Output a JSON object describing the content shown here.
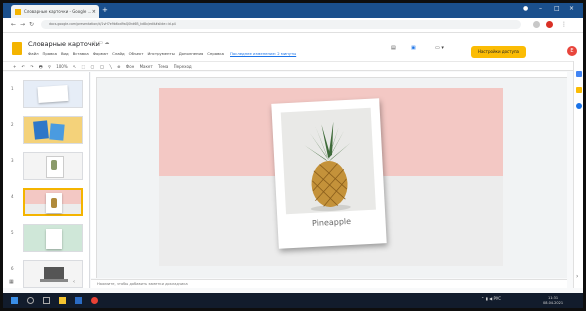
{
  "browser": {
    "tab_title": "Словарные карточки - Google ...",
    "url": "docs.google.com/presentation/d/1vH7e9b6xd9aQ0hd6B_kd8x/edit#slide=id.p4"
  },
  "app": {
    "doc_title": "Словарные карточки",
    "menu": [
      "Файл",
      "Правка",
      "Вид",
      "Вставка",
      "Формат",
      "Слайд",
      "Объект",
      "Инструменты",
      "Дополнения",
      "Справка"
    ],
    "last_edit_note": "Последнее изменение: 2 минуты",
    "share_label": "Настройки доступа",
    "avatar_letter": "Е"
  },
  "toolbar": {
    "items": [
      "+",
      "↶",
      "↷",
      "🖶",
      "⚲",
      "100%",
      "↖",
      "⬚",
      "▢",
      "◯",
      "╲",
      "⊕",
      "Фон",
      "Макет",
      "Тема",
      "Переход"
    ]
  },
  "filmstrip": {
    "selected": 4,
    "slides": [
      {
        "num": "1",
        "bg": "#e6edf7"
      },
      {
        "num": "2",
        "bg": "#f4d27a"
      },
      {
        "num": "3",
        "bg": "#f4f4f4"
      },
      {
        "num": "4",
        "bg": "#f3c8c4"
      },
      {
        "num": "5",
        "bg": "#cfe7d8"
      },
      {
        "num": "6",
        "bg": "#f4f4f4"
      }
    ]
  },
  "slide": {
    "caption": "Pineapple"
  },
  "notes": {
    "placeholder": "Нажмите, чтобы добавить заметки докладчика"
  },
  "taskbar": {
    "tray_text": "РУС",
    "time": "11:31",
    "date": "08.04.2021"
  },
  "colors": {
    "brand": "#f4b400",
    "accent_band": "#f3c8c4",
    "taskbar": "#121c2c",
    "browser_frame": "#1a4f8c"
  }
}
